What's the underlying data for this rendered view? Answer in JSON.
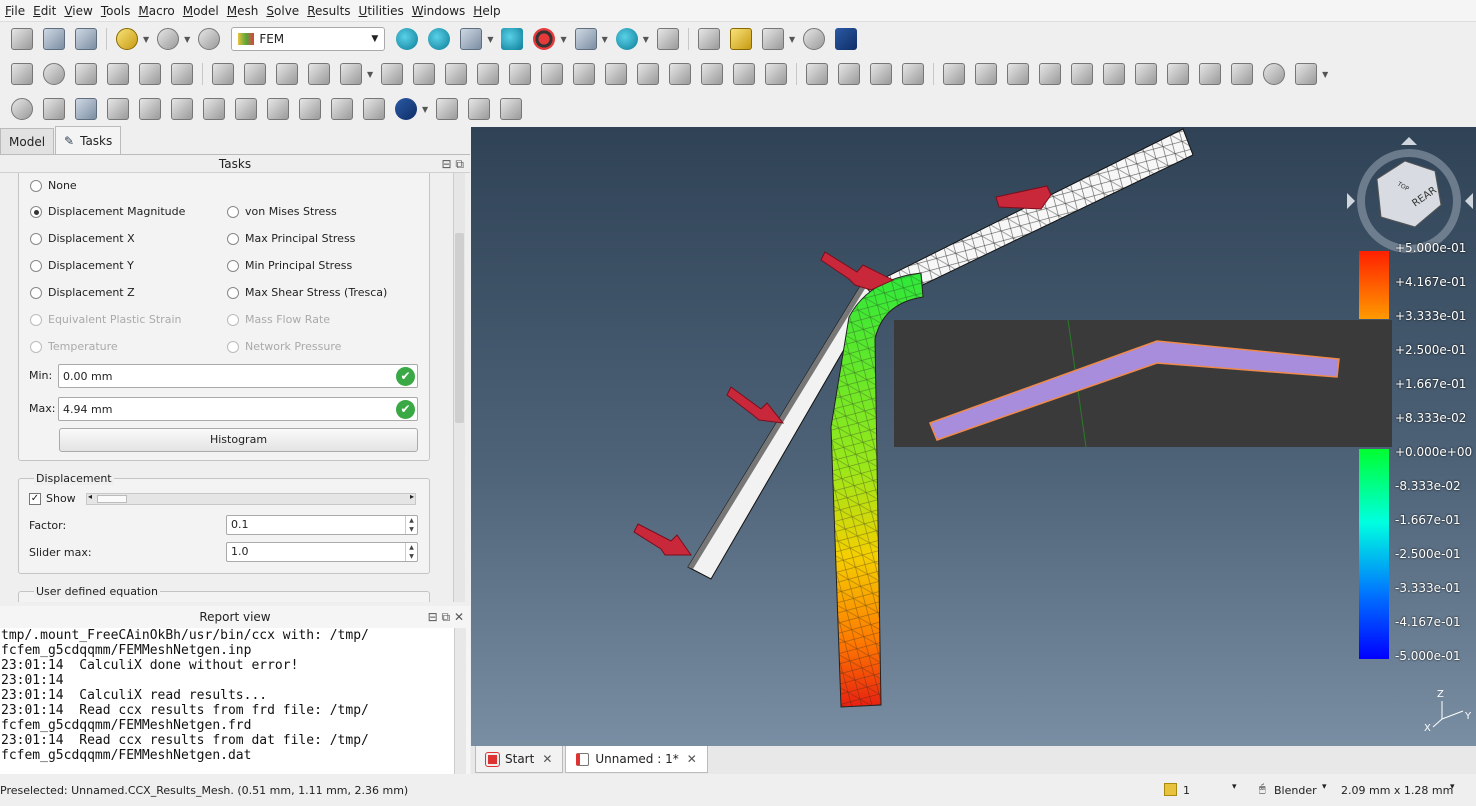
{
  "menu": [
    "File",
    "Edit",
    "View",
    "Tools",
    "Macro",
    "Model",
    "Mesh",
    "Solve",
    "Results",
    "Utilities",
    "Windows",
    "Help"
  ],
  "workbench": "FEM",
  "left_tabs": [
    "Model",
    "Tasks"
  ],
  "tasks": {
    "title": "Tasks",
    "result_types": [
      {
        "label": "None",
        "checked": false,
        "disabled": false
      },
      {
        "label": "Displacement Magnitude",
        "checked": true,
        "disabled": false
      },
      {
        "label": "von Mises Stress",
        "checked": false,
        "disabled": false
      },
      {
        "label": "Displacement X",
        "checked": false,
        "disabled": false
      },
      {
        "label": "Max Principal Stress",
        "checked": false,
        "disabled": false
      },
      {
        "label": "Displacement Y",
        "checked": false,
        "disabled": false
      },
      {
        "label": "Min Principal Stress",
        "checked": false,
        "disabled": false
      },
      {
        "label": "Displacement Z",
        "checked": false,
        "disabled": false
      },
      {
        "label": "Max Shear Stress (Tresca)",
        "checked": false,
        "disabled": false
      },
      {
        "label": "Equivalent Plastic Strain",
        "checked": false,
        "disabled": true
      },
      {
        "label": "Mass Flow Rate",
        "checked": false,
        "disabled": true
      },
      {
        "label": "Temperature",
        "checked": false,
        "disabled": true
      },
      {
        "label": "Network Pressure",
        "checked": false,
        "disabled": true
      }
    ],
    "min_label": "Min:",
    "min_value": "0.00 mm",
    "max_label": "Max:",
    "max_value": "4.94 mm",
    "histogram_label": "Histogram",
    "displacement": {
      "title": "Displacement",
      "show_label": "Show",
      "show_checked": true,
      "factor_label": "Factor:",
      "factor_value": "0.1",
      "slider_max_label": "Slider max:",
      "slider_max_value": "1.0"
    },
    "user_defined_title": "User defined equation"
  },
  "report": {
    "title": "Report view",
    "lines": [
      "tmp/.mount_FreeCAinOkBh/usr/bin/ccx with: /tmp/",
      "fcfem_g5cdqqmm/FEMMeshNetgen.inp",
      "23:01:14  CalculiX done without error!",
      "23:01:14",
      "23:01:14  CalculiX read results...",
      "23:01:14  Read ccx results from frd file: /tmp/",
      "fcfem_g5cdqqmm/FEMMeshNetgen.frd",
      "23:01:14  Read ccx results from dat file: /tmp/",
      "fcfem_g5cdqqmm/FEMMeshNetgen.dat"
    ]
  },
  "legend": {
    "labels": [
      "+5.000e-01",
      "+4.167e-01",
      "+3.333e-01",
      "+2.500e-01",
      "+1.667e-01",
      "+8.333e-02",
      "+0.000e+00",
      "-8.333e-02",
      "-1.667e-01",
      "-2.500e-01",
      "-3.333e-01",
      "-4.167e-01",
      "-5.000e-01"
    ]
  },
  "navcube": {
    "face_label": "REAR",
    "top_label": "TOP"
  },
  "axis": {
    "z": "Z",
    "y": "Y",
    "x": "X"
  },
  "view_tabs": [
    {
      "label": "Start",
      "active": false
    },
    {
      "label": "Unnamed : 1*",
      "active": true
    }
  ],
  "status": {
    "preselected": "Preselected: Unnamed.CCX_Results_Mesh. (0.51 mm, 1.11 mm, 2.36 mm)",
    "count": "1",
    "nav_style": "Blender",
    "dimensions": "2.09 mm x 1.28 mm"
  },
  "colors": {
    "accent": "#3aa845",
    "arrow": "#c8283a",
    "legend_top": "#ff2a00",
    "legend_bottom": "#0000ff"
  }
}
